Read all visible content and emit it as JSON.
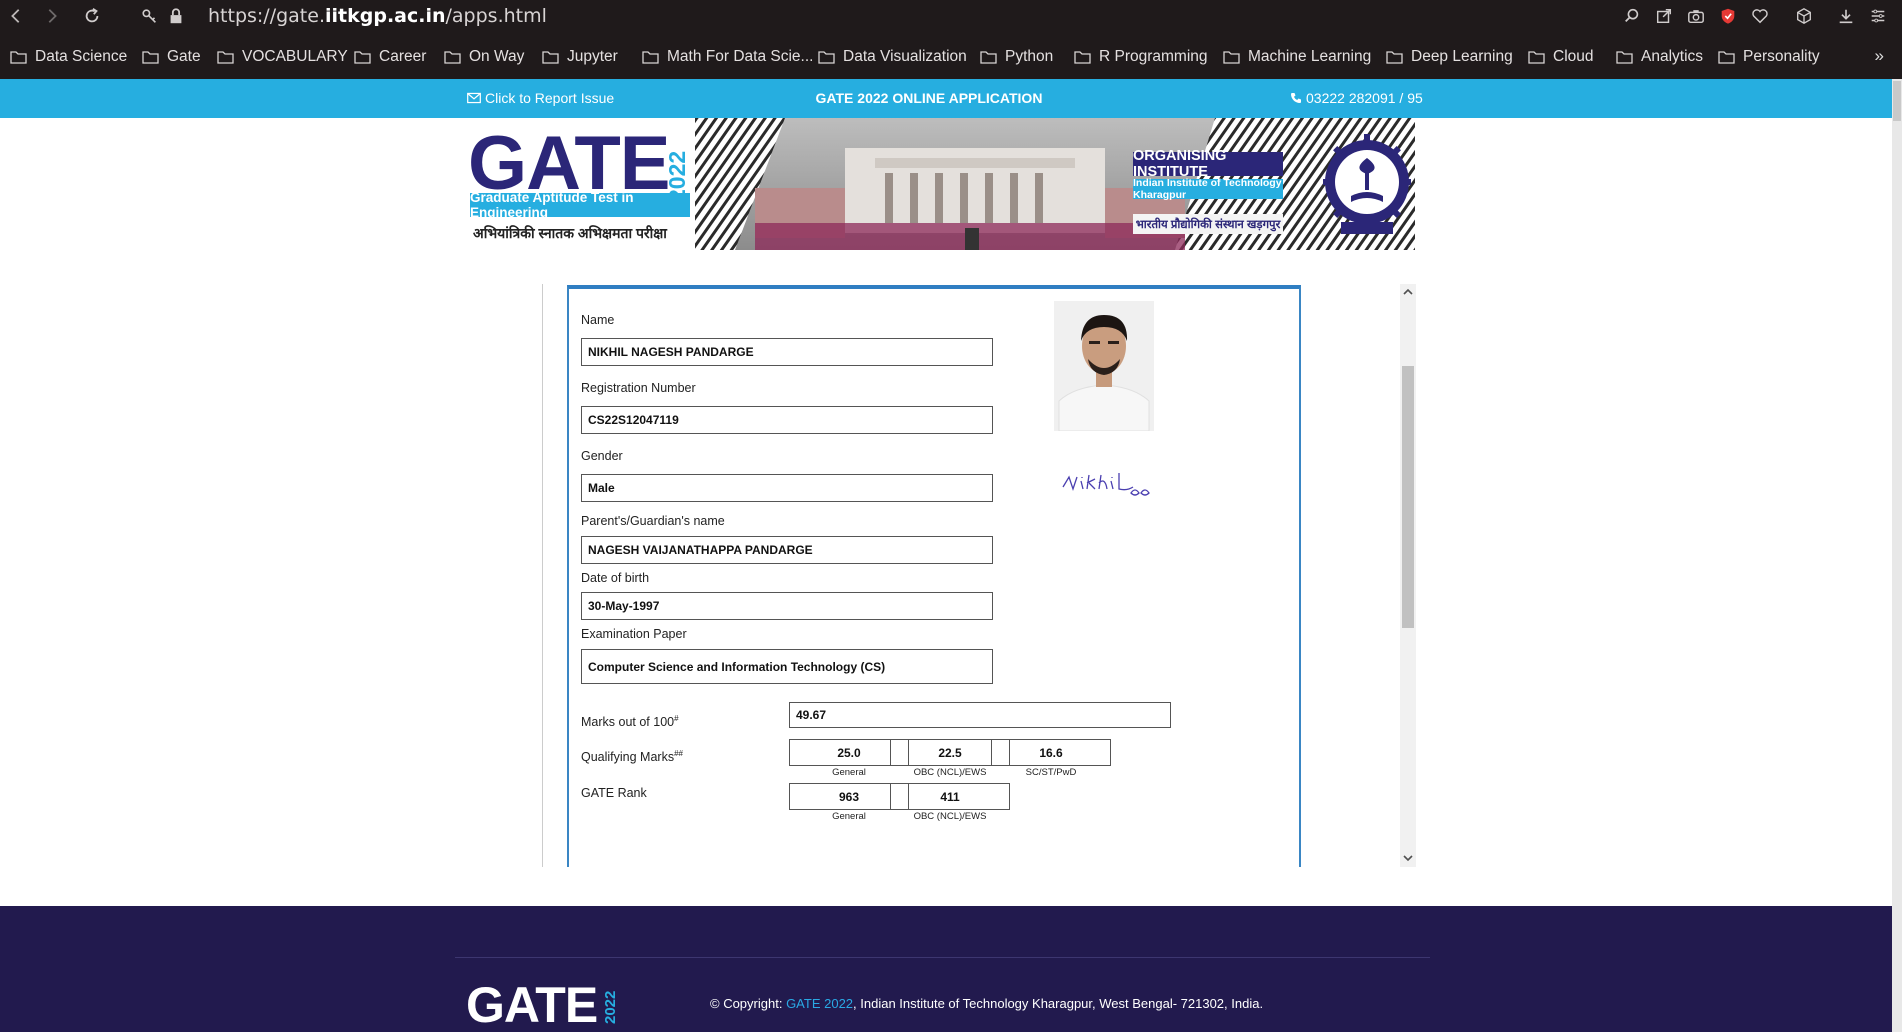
{
  "browser": {
    "url_prefix": "https://gate.",
    "url_domain": "iitkgp.ac.in",
    "url_path": "/apps.html",
    "bookmarks": [
      "Data Science",
      "Gate",
      "VOCABULARY",
      "Career",
      "On Way",
      "Jupyter",
      "Math For Data Scie...",
      "Data Visualization",
      "Python",
      "R Programming",
      "Machine Learning",
      "Deep Learning",
      "Cloud",
      "Analytics",
      "Personality"
    ],
    "bookmarks_more": "»"
  },
  "topbar": {
    "report_issue": "Click to Report Issue",
    "title": "GATE 2022 ONLINE APPLICATION",
    "phone": "03222 282091 / 95"
  },
  "banner": {
    "gate": "GATE",
    "year": "2022",
    "subtitle": "Graduate Aptitude Test in Engineering",
    "hindi": "अभियांत्रिकी स्नातक अभिक्षमता परीक्षा",
    "organising": "ORGANISING INSTITUTE",
    "institute": "Indian Institute of Technology Kharagpur",
    "institute_hindi": "भारतीय प्रौद्योगिकी संस्थान खड़गपुर"
  },
  "scorecard": {
    "name_label": "Name",
    "name": "NIKHIL NAGESH PANDARGE",
    "regno_label": "Registration Number",
    "regno": "CS22S12047119",
    "gender_label": "Gender",
    "gender": "Male",
    "guardian_label": "Parent's/Guardian's name",
    "guardian": "NAGESH VAIJANATHAPPA PANDARGE",
    "dob_label": "Date of birth",
    "dob": "30-May-1997",
    "paper_label": "Examination Paper",
    "paper": "Computer Science and Information Technology (CS)",
    "signature": "Nikhil",
    "marks_label": "Marks out of 100",
    "marks_sup": "#",
    "marks": "49.67",
    "qual_label": "Qualifying Marks",
    "qual_sup": "##",
    "qual": [
      {
        "value": "25.0",
        "category": "General"
      },
      {
        "value": "22.5",
        "category": "OBC (NCL)/EWS"
      },
      {
        "value": "16.6",
        "category": "SC/ST/PwD"
      }
    ],
    "rank_label": "GATE Rank",
    "rank": [
      {
        "value": "963",
        "category": "General"
      },
      {
        "value": "411",
        "category": "OBC (NCL)/EWS"
      }
    ]
  },
  "footer": {
    "gate": "GATE",
    "year": "2022",
    "copyright_prefix": "© Copyright: ",
    "copyright_link": "GATE 2022",
    "copyright_suffix": ", Indian Institute of Technology Kharagpur, West Bengal- 721302, India."
  }
}
